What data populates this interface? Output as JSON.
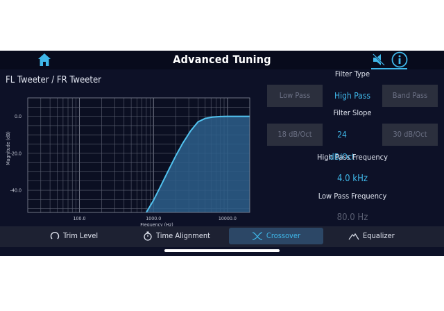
{
  "header": {
    "title": "Advanced Tuning",
    "icons": [
      "home-icon",
      "speaker-muted-icon",
      "info-icon"
    ]
  },
  "channel_title": "FL Tweeter / FR Tweeter",
  "chart_data": {
    "type": "line",
    "xlabel": "Frequency (Hz)",
    "ylabel": "Magnitude (dB)",
    "x_scale": "log",
    "xlim": [
      20,
      20000
    ],
    "ylim": [
      -52,
      10
    ],
    "x_ticks": [
      100,
      1000,
      10000
    ],
    "x_tick_labels": [
      "100.0",
      "1000.0",
      "10000.0"
    ],
    "y_ticks": [
      0,
      -20,
      -40
    ],
    "y_tick_labels": [
      "0.0",
      "-20.0",
      "-40.0"
    ],
    "grid": true,
    "series": [
      {
        "x": [
          800,
          1000,
          1260,
          1600,
          2000,
          2500,
          3200,
          4000,
          5000,
          6300,
          8000,
          10000,
          20000
        ],
        "values": [
          -52,
          -45.5,
          -37.5,
          -29.1,
          -21.4,
          -14.4,
          -7.7,
          -3.0,
          -1.1,
          -0.4,
          -0.1,
          0,
          0
        ]
      }
    ],
    "fill": true
  },
  "filter_type": {
    "heading": "Filter Type",
    "options": [
      "Low Pass",
      "High Pass",
      "Band Pass"
    ],
    "selected": "High Pass"
  },
  "filter_slope": {
    "heading": "Filter Slope",
    "options": [
      "18 dB/Oct",
      "24 dB/Oct",
      "30 dB/Oct"
    ],
    "selected": "24 dB/Oct"
  },
  "high_pass": {
    "heading": "High Pass Frequency",
    "value": "4.0 kHz"
  },
  "low_pass": {
    "heading": "Low Pass Frequency",
    "value": "80.0 Hz"
  },
  "tabs": [
    {
      "label": "Trim Level",
      "icon": "trim-knob-icon"
    },
    {
      "label": "Time Alignment",
      "icon": "stopwatch-icon"
    },
    {
      "label": "Crossover",
      "icon": "crossover-icon",
      "active": true
    },
    {
      "label": "Equalizer",
      "icon": "equalizer-icon"
    }
  ],
  "colors": {
    "accent": "#3fb7e9",
    "background": "#0d1127",
    "tab_bar": "#1d2132",
    "active_tab": "#2c4766",
    "option_bg": "#2b2f3d"
  }
}
